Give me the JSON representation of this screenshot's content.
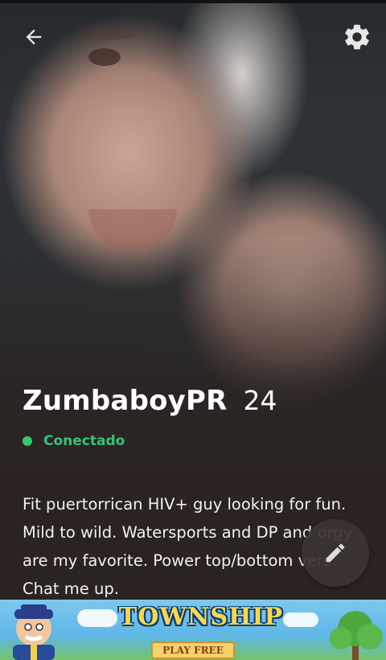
{
  "profile": {
    "name": "ZumbaboyPR",
    "age": "24",
    "status": "Conectado",
    "bio": "Fit puertorrican HIV+ guy looking for fun. Mild to wild. Watersports and DP and orgy are my favorite. Power top/bottom vers. Chat me up."
  },
  "icons": {
    "back": "arrow-left-icon",
    "settings": "gear-icon",
    "edit": "pencil-icon"
  },
  "colors": {
    "online": "#2ecc71",
    "status_text": "#35c37a"
  },
  "ad": {
    "title": "TOWNSHIP",
    "cta": "PLAY FREE"
  }
}
